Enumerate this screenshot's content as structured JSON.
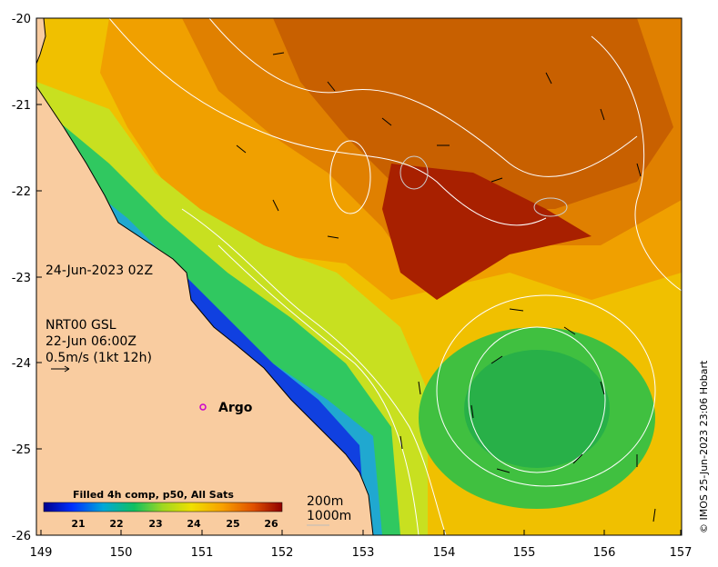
{
  "map": {
    "timestamp": "24-Jun-2023 02Z",
    "velocity_source": "NRT00 GSL",
    "velocity_time": "22-Jun 06:00Z",
    "velocity_scale": "0.5m/s (1kt 12h)",
    "argo_label": "Argo",
    "colorbar_title": "Filled 4h comp, p50, All Sats",
    "colorbar_ticks": [
      "21",
      "22",
      "23",
      "24",
      "25",
      "26"
    ],
    "contour_200": "200m",
    "contour_1000": "1000m",
    "credit": "© IMOS 25-Jun-2023 23:06 Hobart",
    "x_ticks": [
      "149",
      "150",
      "151",
      "152",
      "153",
      "154",
      "155",
      "156",
      "157"
    ],
    "y_ticks": [
      "-20",
      "-21",
      "-22",
      "-23",
      "-24",
      "-25",
      "-26"
    ],
    "colors": {
      "land": "#f9cca0",
      "argo_marker": "#cc00cc"
    }
  }
}
